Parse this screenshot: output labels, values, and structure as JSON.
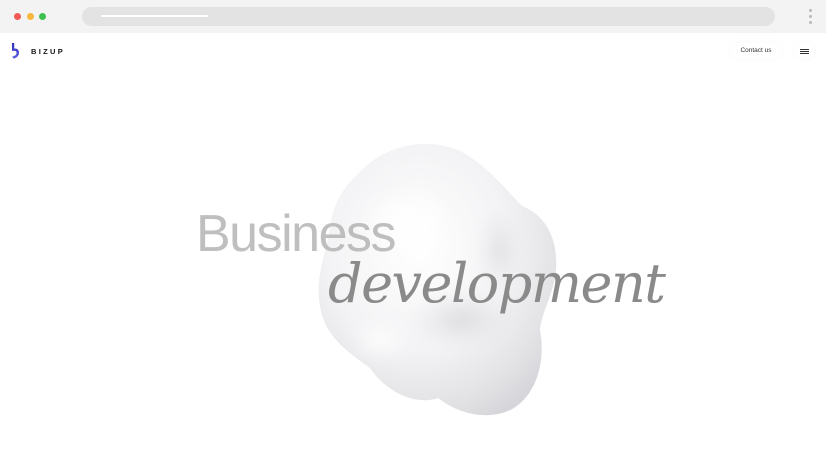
{
  "browser": {
    "address_bar_placeholder": ""
  },
  "header": {
    "brand": "BIZUP",
    "contact_label": "Contact us"
  },
  "hero": {
    "line1": "Business",
    "line2": "development"
  },
  "icons": {
    "logo": "bizup-logo-icon",
    "menu": "hamburger-menu-icon",
    "browser_menu": "kebab-menu-icon"
  },
  "colors": {
    "accent": "#3b3fd0",
    "text_dark": "#161616",
    "hero_light": "#b4b4b4",
    "hero_italic": "#8a8a8a"
  }
}
